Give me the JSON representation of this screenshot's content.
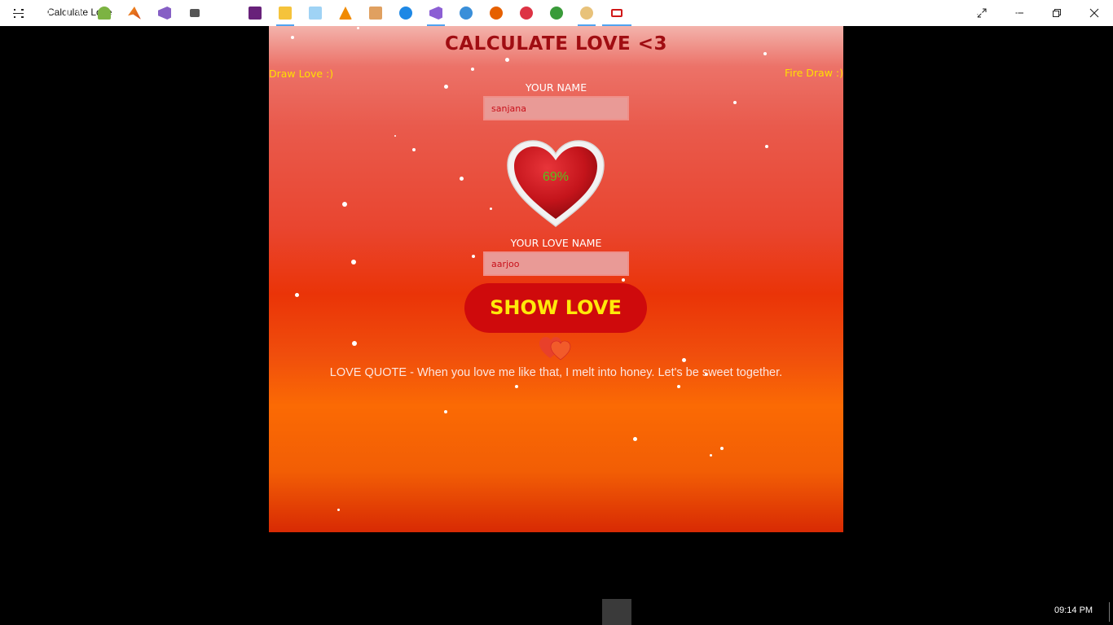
{
  "window": {
    "title": "Calculate Love",
    "controls": [
      "full-screen",
      "minimize",
      "restore",
      "close"
    ]
  },
  "app": {
    "heading": "CALCULATE LOVE <3",
    "draw_love_link": "Draw Love :)",
    "fire_draw_link": "Fire Draw :)",
    "your_name_label": "YOUR NAME",
    "your_name_value": "sanjana",
    "love_percent": "69%",
    "your_love_name_label": "YOUR LOVE NAME",
    "your_love_name_value": "aarjoo",
    "show_button_label": "SHOW LOVE",
    "quote": "LOVE QUOTE - When you love me like that, I melt into honey. Let's be sweet together.",
    "colors": {
      "heading": "#a00d12",
      "link": "#ffe000",
      "button_bg": "#cf0a0c",
      "button_text": "#ffe90a",
      "percent": "#59c21b"
    }
  },
  "taskbar": {
    "icons": [
      "windows-start-icon",
      "search-icon",
      "task-view-icon",
      "android-studio-icon",
      "matlab-icon",
      "visual-studio-icon",
      "media-player-icon",
      "store-icon",
      "visual-studio-purple-icon",
      "file-explorer-icon",
      "notepad-icon",
      "vlc-icon",
      "tools-icon",
      "edge-icon",
      "visual-studio-code-icon",
      "app-globe-icon",
      "firefox-icon",
      "app-gear-icon",
      "app-earth-icon",
      "paint-icon",
      "calculate-love-app-icon"
    ],
    "tray_icons": [
      "chevron-up-icon",
      "wifi-icon",
      "battery-icon",
      "volume-icon",
      "notification-icon"
    ],
    "clock": "09:14 PM"
  }
}
